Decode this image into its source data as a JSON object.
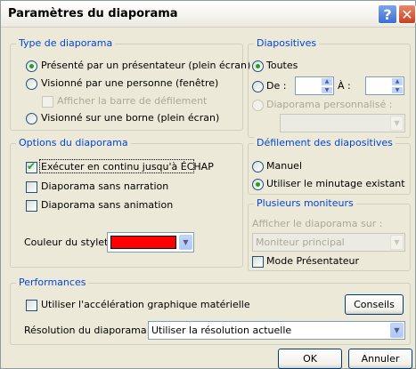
{
  "window": {
    "title": "Paramètres du diaporama",
    "help_icon": "help-icon",
    "close_icon": "close-icon"
  },
  "type_diaporama": {
    "legend": "Type de diaporama",
    "options": [
      {
        "label": "Présenté par un présentateur (plein écran)",
        "selected": true
      },
      {
        "label": "Visionné par une personne (fenêtre)",
        "selected": false
      },
      {
        "label": "Visionné sur une borne (plein écran)",
        "selected": false
      }
    ],
    "scrollbar_label": "Afficher la barre de défilement",
    "scrollbar_checked": false
  },
  "diapositives": {
    "legend": "Diapositives",
    "toutes_label": "Toutes",
    "toutes_selected": true,
    "de_label": "De :",
    "a_label": "À :",
    "de_value": "",
    "a_value": "",
    "custom_label": "Diaporama personnalisé :",
    "custom_value": ""
  },
  "options": {
    "legend": "Options du diaporama",
    "loop_label": "Exécuter en continu jusqu'à ÉCHAP",
    "loop_checked": true,
    "no_narration_label": "Diaporama sans narration",
    "no_narration_checked": false,
    "no_animation_label": "Diaporama sans animation",
    "no_animation_checked": false,
    "pen_color_label": "Couleur du stylet :",
    "pen_color": "#ff0000"
  },
  "defilement": {
    "legend": "Défilement des diapositives",
    "manuel_label": "Manuel",
    "manuel_selected": false,
    "timing_label": "Utiliser le minutage existant",
    "timing_selected": true
  },
  "moniteurs": {
    "legend": "Plusieurs moniteurs",
    "display_on_label": "Afficher le diaporama sur :",
    "monitor_value": "Moniteur principal",
    "presenter_mode_label": "Mode Présentateur",
    "presenter_mode_checked": false
  },
  "performances": {
    "legend": "Performances",
    "hw_accel_label": "Utiliser l'accélération graphique matérielle",
    "hw_accel_checked": false,
    "tips_button": "Conseils",
    "resolution_label": "Résolution du diaporama :",
    "resolution_value": "Utiliser la résolution actuelle"
  },
  "footer": {
    "ok_label": "OK",
    "cancel_label": "Annuler"
  },
  "colors": {
    "legend_blue": "#0046d5",
    "face": "#ece9d8",
    "radio_dot": "#21a121"
  }
}
